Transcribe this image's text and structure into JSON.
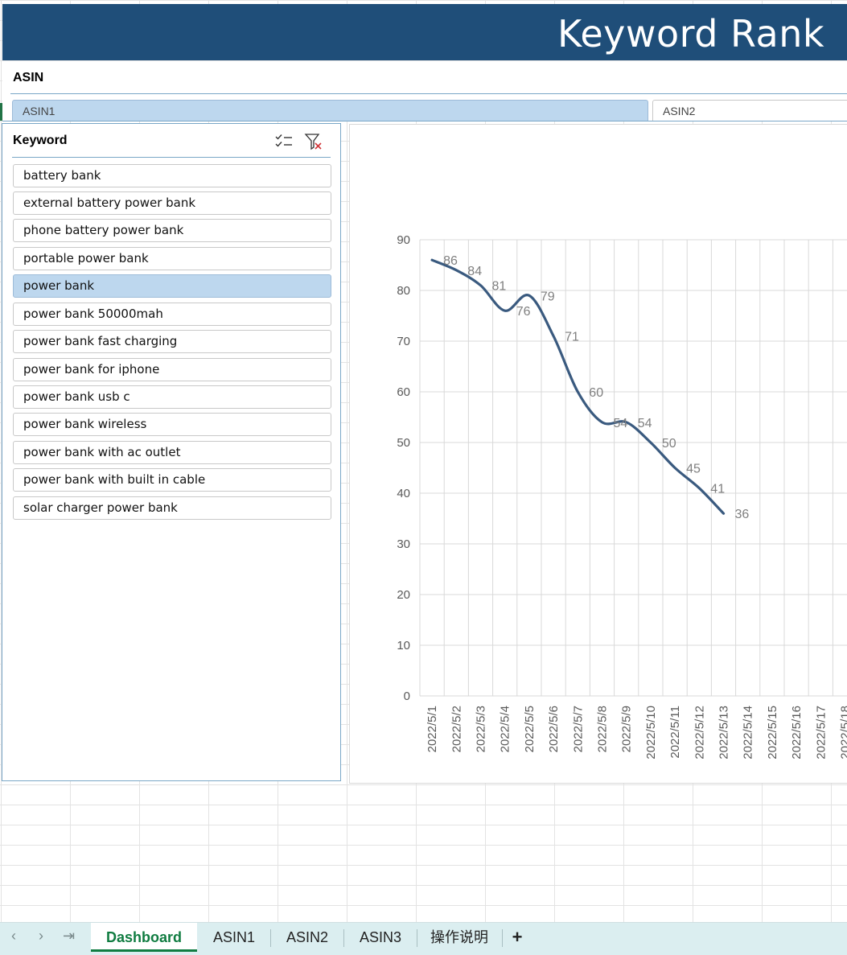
{
  "dashboard": {
    "title": "Keyword Rank"
  },
  "asin_slicer": {
    "header": "ASIN",
    "items": [
      {
        "label": "ASIN1",
        "selected": true
      },
      {
        "label": "ASIN2",
        "selected": false
      }
    ]
  },
  "keyword_slicer": {
    "header": "Keyword",
    "icons": [
      "multi-select-icon",
      "clear-filter-icon"
    ],
    "items": [
      {
        "label": "battery bank",
        "selected": false
      },
      {
        "label": "external battery power bank",
        "selected": false
      },
      {
        "label": "phone battery power bank",
        "selected": false
      },
      {
        "label": "portable power bank",
        "selected": false
      },
      {
        "label": "power bank",
        "selected": true
      },
      {
        "label": "power bank 50000mah",
        "selected": false
      },
      {
        "label": "power bank fast charging",
        "selected": false
      },
      {
        "label": "power bank for iphone",
        "selected": false
      },
      {
        "label": "power bank usb c",
        "selected": false
      },
      {
        "label": "power bank wireless",
        "selected": false
      },
      {
        "label": "power bank with ac outlet",
        "selected": false
      },
      {
        "label": "power bank with built in cable",
        "selected": false
      },
      {
        "label": "solar charger power bank",
        "selected": false
      }
    ]
  },
  "chart_data": {
    "type": "line",
    "x": [
      "2022/5/1",
      "2022/5/2",
      "2022/5/3",
      "2022/5/4",
      "2022/5/5",
      "2022/5/6",
      "2022/5/7",
      "2022/5/8",
      "2022/5/9",
      "2022/5/10",
      "2022/5/11",
      "2022/5/12",
      "2022/5/13",
      "2022/5/14",
      "2022/5/15",
      "2022/5/16",
      "2022/5/17",
      "2022/5/18"
    ],
    "series": [
      {
        "values": [
          86,
          84,
          81,
          76,
          79,
          71,
          60,
          54,
          54,
          50,
          45,
          41,
          36,
          null,
          null,
          null,
          null,
          null
        ]
      }
    ],
    "ylim": [
      0,
      90
    ],
    "yticks": [
      0,
      10,
      20,
      30,
      40,
      50,
      60,
      70,
      80,
      90
    ],
    "grid": true,
    "smooth": true,
    "line_color": "#3a5a7f",
    "data_labels": true
  },
  "sheet_tabs": {
    "nav": [
      "‹",
      "›",
      "⇥"
    ],
    "tabs": [
      {
        "label": "Dashboard",
        "active": true
      },
      {
        "label": "ASIN1",
        "active": false
      },
      {
        "label": "ASIN2",
        "active": false
      },
      {
        "label": "ASIN3",
        "active": false
      },
      {
        "label": "操作说明",
        "active": false
      }
    ],
    "add": "+"
  }
}
